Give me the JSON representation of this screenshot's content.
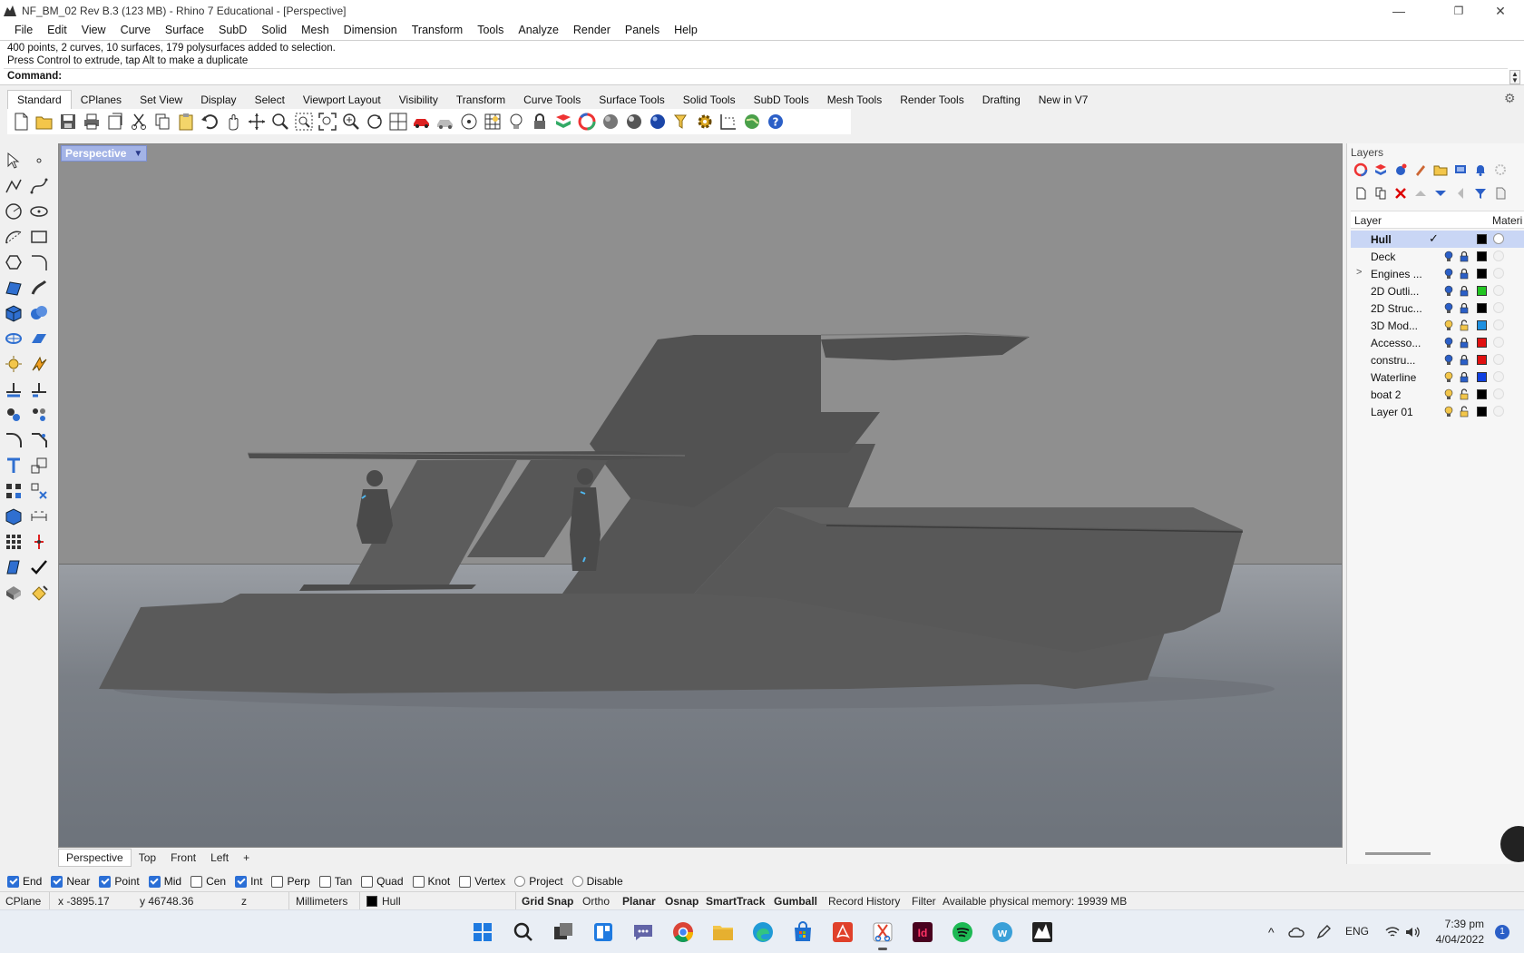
{
  "window": {
    "title": "NF_BM_02 Rev B.3 (123 MB) - Rhino 7 Educational - [Perspective]",
    "minimize_glyph": "—",
    "restore_glyph": "❐",
    "close_glyph": "✕"
  },
  "menu": [
    "File",
    "Edit",
    "View",
    "Curve",
    "Surface",
    "SubD",
    "Solid",
    "Mesh",
    "Dimension",
    "Transform",
    "Tools",
    "Analyze",
    "Render",
    "Panels",
    "Help"
  ],
  "command": {
    "history_line1": "400 points, 2 curves, 10 surfaces, 179 polysurfaces added to selection.",
    "history_line2": "Press Control to extrude, tap Alt to make a duplicate",
    "prompt": "Command:",
    "input_value": ""
  },
  "toolbar_tabs": [
    "Standard",
    "CPlanes",
    "Set View",
    "Display",
    "Select",
    "Viewport Layout",
    "Visibility",
    "Transform",
    "Curve Tools",
    "Surface Tools",
    "Solid Tools",
    "SubD Tools",
    "Mesh Tools",
    "Render Tools",
    "Drafting",
    "New in V7"
  ],
  "active_toolbar_tab": "Standard",
  "standard_toolbar_icons": [
    "new-file-icon",
    "open-file-icon",
    "save-icon",
    "print-icon",
    "import-icon",
    "cut-icon",
    "copy-icon",
    "paste-icon",
    "undo-icon",
    "pan-icon",
    "rotate-view-icon",
    "zoom-icon",
    "zoom-window-icon",
    "zoom-extents-icon",
    "zoom-selected-icon",
    "rotate-icon",
    "four-view-icon",
    "car-icon",
    "render-preview-icon",
    "circle-target-icon",
    "grid-icon",
    "lightbulb-icon",
    "lock-icon",
    "layer-shield-icon",
    "color-wheel-icon",
    "sphere-shaded-icon",
    "sphere-rendered-icon",
    "sphere-blue-icon",
    "highlighter-icon",
    "gear-cog-icon",
    "dimension-icon",
    "globe-icon",
    "help-icon"
  ],
  "viewport": {
    "name": "Perspective",
    "tabs": [
      "Perspective",
      "Top",
      "Front",
      "Left"
    ],
    "active_tab": "Perspective",
    "add_tab_glyph": "+",
    "menu_arrow_glyph": "▼"
  },
  "layers_panel": {
    "title": "Layers",
    "col_layer": "Layer",
    "col_material": "Materi",
    "current_mark": "✓",
    "expand_glyph": ">",
    "layers": [
      {
        "name": "Hull",
        "current": true,
        "color": "#000000",
        "bulb": "on",
        "lock": "none"
      },
      {
        "name": "Deck",
        "current": false,
        "color": "#000000",
        "bulb": "off",
        "lock": "locked"
      },
      {
        "name": "Engines ...",
        "current": false,
        "color": "#000000",
        "bulb": "off",
        "lock": "locked",
        "expandable": true
      },
      {
        "name": "2D Outli...",
        "current": false,
        "color": "#22c522",
        "bulb": "off",
        "lock": "locked"
      },
      {
        "name": "2D Struc...",
        "current": false,
        "color": "#000000",
        "bulb": "off",
        "lock": "locked"
      },
      {
        "name": "3D Mod...",
        "current": false,
        "color": "#1e90e0",
        "bulb": "on",
        "lock": "unlocked"
      },
      {
        "name": "Accesso...",
        "current": false,
        "color": "#e01010",
        "bulb": "off",
        "lock": "locked"
      },
      {
        "name": "constru...",
        "current": false,
        "color": "#e01010",
        "bulb": "off",
        "lock": "locked"
      },
      {
        "name": "Waterline",
        "current": false,
        "color": "#1040e0",
        "bulb": "on",
        "lock": "locked"
      },
      {
        "name": "boat 2",
        "current": false,
        "color": "#000000",
        "bulb": "on",
        "lock": "unlocked"
      },
      {
        "name": "Layer 01",
        "current": false,
        "color": "#000000",
        "bulb": "on",
        "lock": "unlocked"
      }
    ]
  },
  "osnaps": [
    {
      "label": "End",
      "checked": true,
      "type": "checkbox"
    },
    {
      "label": "Near",
      "checked": true,
      "type": "checkbox"
    },
    {
      "label": "Point",
      "checked": true,
      "type": "checkbox"
    },
    {
      "label": "Mid",
      "checked": true,
      "type": "checkbox"
    },
    {
      "label": "Cen",
      "checked": false,
      "type": "checkbox"
    },
    {
      "label": "Int",
      "checked": true,
      "type": "checkbox"
    },
    {
      "label": "Perp",
      "checked": false,
      "type": "checkbox"
    },
    {
      "label": "Tan",
      "checked": false,
      "type": "checkbox"
    },
    {
      "label": "Quad",
      "checked": false,
      "type": "checkbox"
    },
    {
      "label": "Knot",
      "checked": false,
      "type": "checkbox"
    },
    {
      "label": "Vertex",
      "checked": false,
      "type": "checkbox"
    },
    {
      "label": "Project",
      "checked": false,
      "type": "radio"
    },
    {
      "label": "Disable",
      "checked": false,
      "type": "radio"
    }
  ],
  "status": {
    "cplane": "CPlane",
    "x": "x -3895.17",
    "y": "y 46748.36",
    "z": "z",
    "units": "Millimeters",
    "layer": "Hull",
    "grid_snap": "Grid Snap",
    "ortho": "Ortho",
    "planar": "Planar",
    "osnap": "Osnap",
    "smarttrack": "SmartTrack",
    "gumball": "Gumball",
    "record_history": "Record History",
    "filter": "Filter",
    "memory": "Available physical memory: 19939 MB"
  },
  "taskbar": {
    "apps": [
      "windows-start-icon",
      "search-icon",
      "task-view-icon",
      "widgets-icon",
      "teams-chat-icon",
      "chrome-icon",
      "file-explorer-icon",
      "edge-icon",
      "store-icon",
      "acrobat-icon",
      "snipping-tool-icon",
      "indesign-icon",
      "spotify-icon",
      "word-icon",
      "rhino-icon"
    ],
    "active_app": "snipping-tool-icon",
    "tray_chevron": "^",
    "language": "ENG",
    "time": "7:39 pm",
    "date": "4/04/2022",
    "notifications": "1"
  },
  "colors": {
    "viewport_sky": "#8f8f8f",
    "model_gray": "#5a5a5a",
    "active_tab_highlight": "#a3b3e6",
    "selected_layer": "#c9d6f5"
  }
}
